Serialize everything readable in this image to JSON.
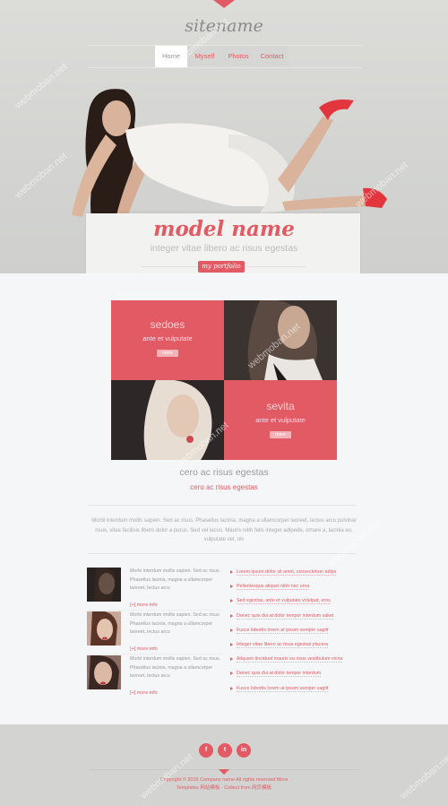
{
  "header": {
    "sitename": "sitename",
    "nav": [
      {
        "label": "Home"
      },
      {
        "label": "Myself"
      },
      {
        "label": "Photos"
      },
      {
        "label": "Contact"
      }
    ]
  },
  "hero": {
    "title": "model name",
    "subtitle": "integer vitae libero ac risus egestas",
    "button": "my portfolio"
  },
  "gallery": {
    "tiles": [
      {
        "title": "sedoes",
        "subtitle": "ante et vulputate",
        "button": "more"
      },
      {
        "title": "sevita",
        "subtitle": "ante et vulputate",
        "button": "more"
      }
    ],
    "title": "cero ac risus egestas",
    "subtitle": "cero ac risus egestas",
    "paragraph": "Morbi interdum mollis sapien. Sed ac risus. Phasellus lacinia, magna a ullamcorper laoreet, lectus arcu pulvinar risus, vitae facilisis libero dolor a purus. Sed vel lacus. Mauris nibh felis integer adipede, ornare a, lacinia eu, vulputate vel, nis"
  },
  "items": [
    {
      "text": "Morbi interdum mollis sapien. Sed ac risus. Phasellus lacinia, magna a ullamcorper laoreet, lectus arcu",
      "more": "[+] more info"
    },
    {
      "text": "Morbi interdum mollis sapien. Sed ac risus. Phasellus lacinia, magna a ullamcorper laoreet, lectus arcu",
      "more": "[+] more info"
    },
    {
      "text": "Morbi interdum mollis sapien. Sed ac risus. Phasellus lacinia, magna a ullamcorper laoreet, lectus arcu",
      "more": "[+] more info"
    }
  ],
  "links": [
    "Lorem ipsum dolor sit amet, consectetuer adips",
    "Pellentesque aliquet nibh nec urna",
    "Sed egestas, ante et vulputate volutpat, eros",
    "Donec quis dui at dolor tempor interdum saket",
    "Fusce lobortis lorem at ipsum semper sagitt",
    "Integer vitae libero ac risus egestas placera",
    "Aliquam tincidunt mauris eu risus vestibulum vicna",
    "Donec quis dui at dolor tempor interdum",
    "Fusce lobortis lorem at ipsum semper sagitt"
  ],
  "footer": {
    "social": [
      "f",
      "t",
      "in"
    ],
    "copyright": "Copyright © 2015 Company name All rights reserved More",
    "credit": "Templates 网站模板 · Collect from 网页模板"
  },
  "watermark": "webmoban.net",
  "colors": {
    "accent": "#e25a63",
    "footer_bg": "#d3d4d1",
    "page_bg": "#f5f6f8"
  }
}
